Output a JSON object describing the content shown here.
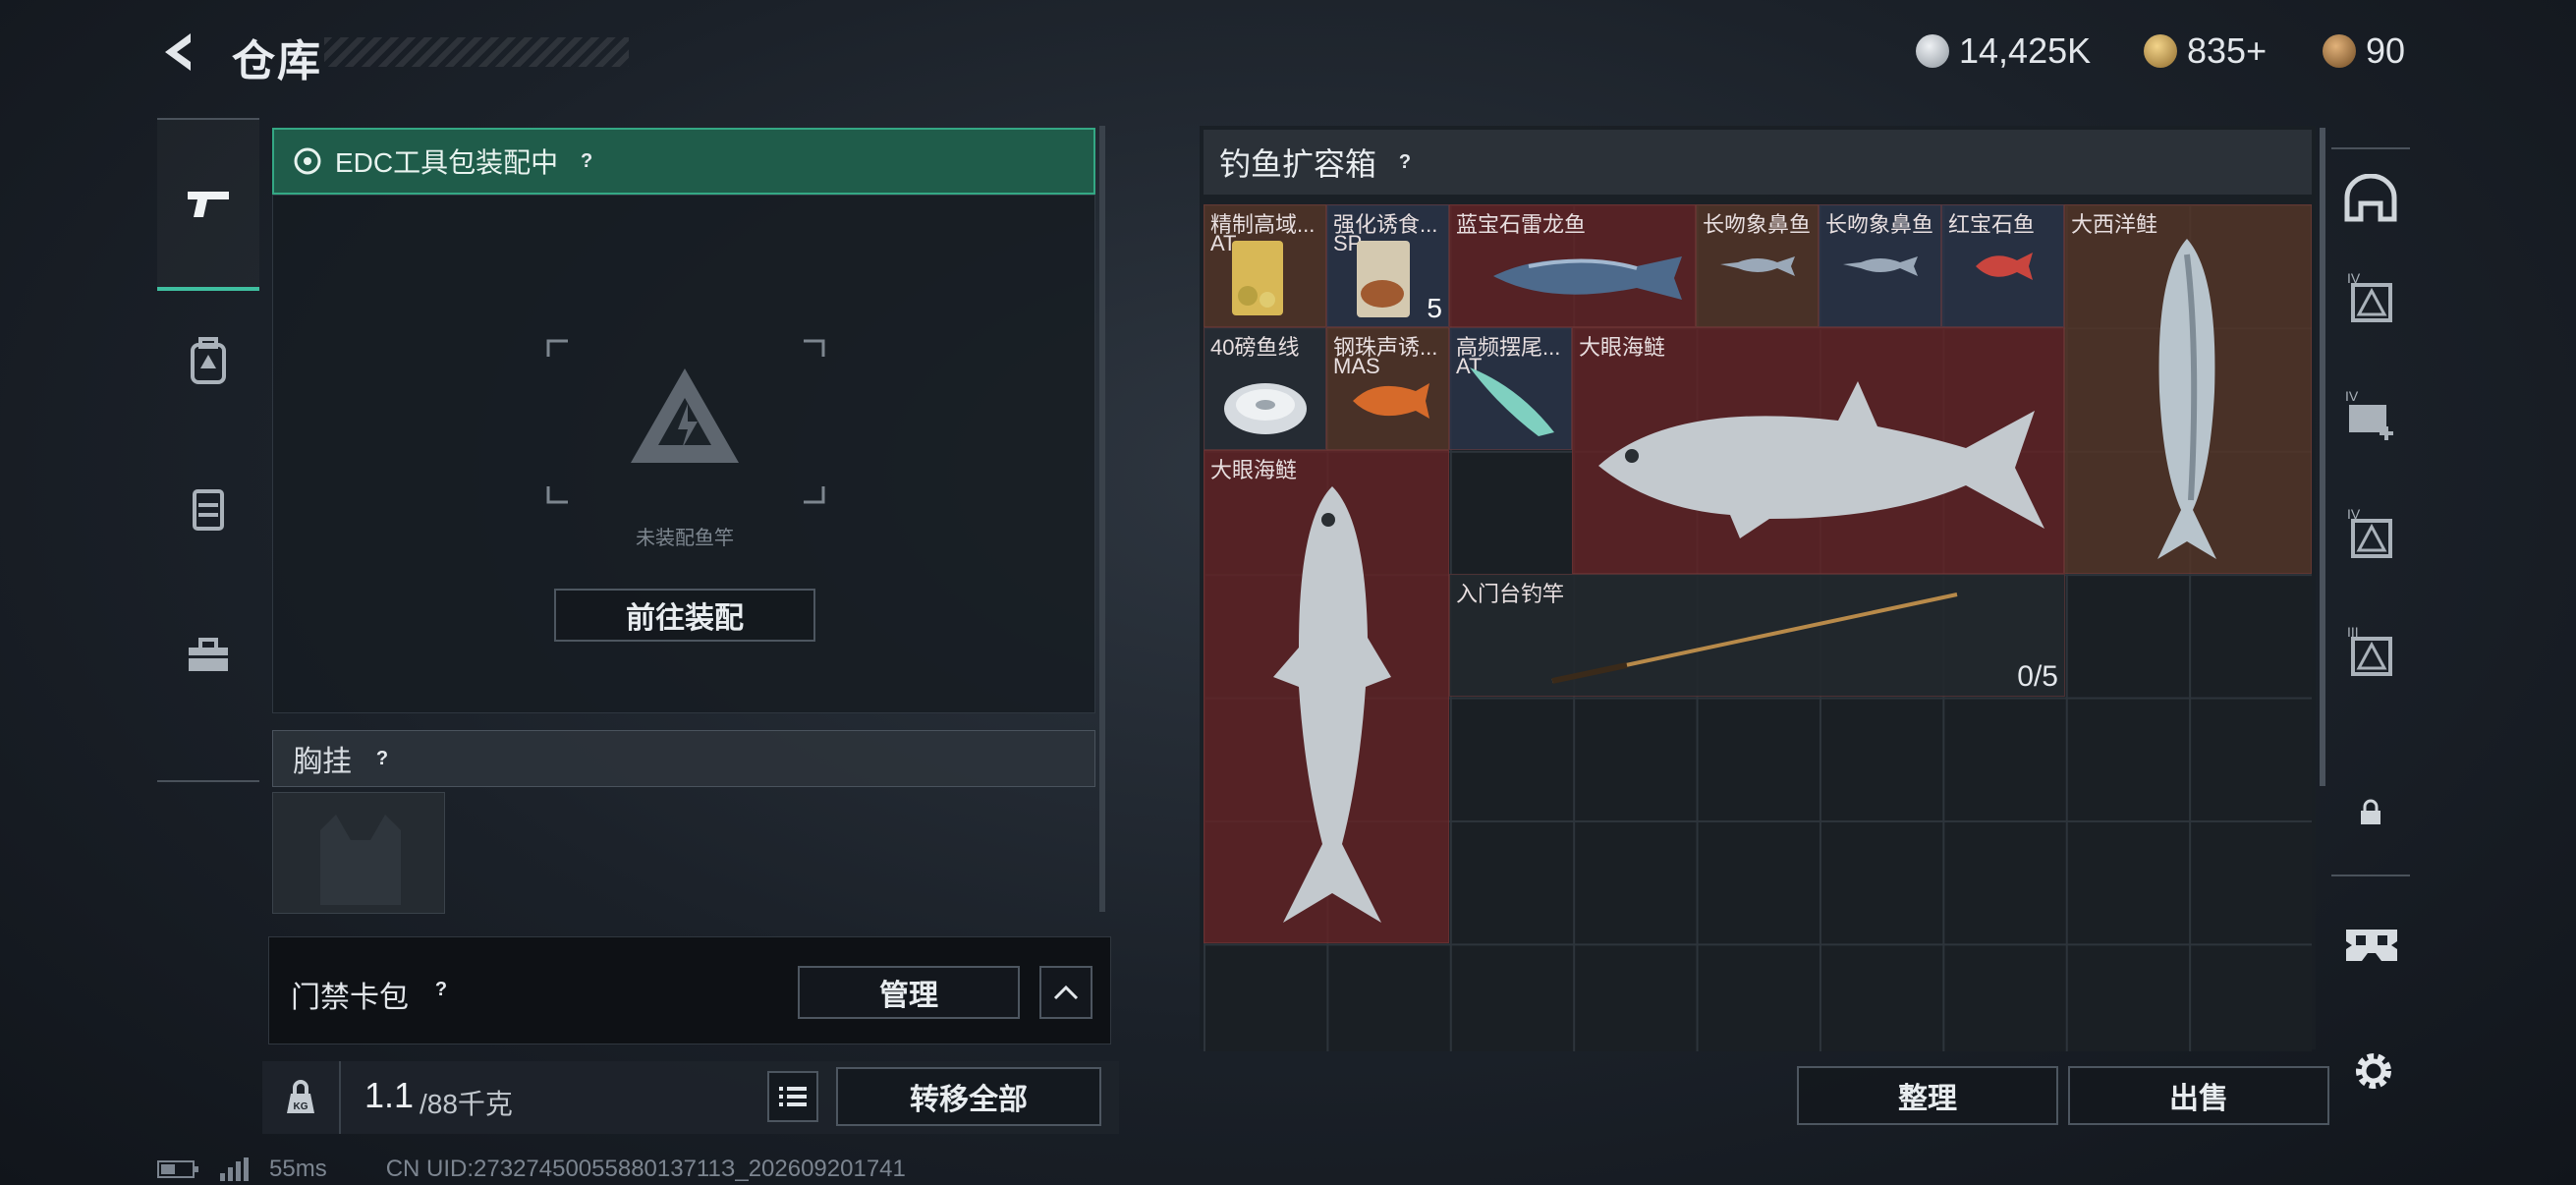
{
  "header": {
    "title": "仓库",
    "currencies": [
      {
        "icon": "silver-coin-icon",
        "value": "14,425K",
        "color": "#b9c0c7"
      },
      {
        "icon": "gold-triangle-coin-icon",
        "value": "835+",
        "color": "#c8a55a"
      },
      {
        "icon": "bronze-coin-icon",
        "value": "90",
        "color": "#b8864a"
      }
    ]
  },
  "left_tabs": [
    {
      "icon": "pistol-icon",
      "active": true
    },
    {
      "icon": "backpack-icon",
      "active": false
    },
    {
      "icon": "vest-icon",
      "active": false
    },
    {
      "icon": "toolbox-icon",
      "active": false
    }
  ],
  "edc": {
    "label": "EDC工具包装配中",
    "help": "?",
    "empty_text": "未装配鱼竿",
    "equip_button": "前往装配"
  },
  "chest_rig": {
    "label": "胸挂",
    "help": "?"
  },
  "keycard": {
    "label": "门禁卡包",
    "help": "?",
    "manage_button": "管理"
  },
  "weight": {
    "current": "1.1",
    "max": "/88千克",
    "kg_badge": "KG",
    "transfer_all_button": "转移全部"
  },
  "container": {
    "title": "钓鱼扩容箱",
    "help": "?",
    "sort_button": "整理",
    "sell_button": "出售",
    "items": [
      {
        "name": "精制高域...",
        "sub": "AT",
        "qty": "",
        "color": "tan",
        "icon": "bait-bag-icon"
      },
      {
        "name": "强化诱食...",
        "sub": "SP",
        "qty": "5",
        "color": "blue",
        "icon": "bait-bag-icon"
      },
      {
        "name": "蓝宝石雷龙鱼",
        "sub": "",
        "qty": "",
        "color": "red",
        "icon": "snakehead-fish-icon"
      },
      {
        "name": "长吻象鼻鱼",
        "sub": "",
        "qty": "",
        "color": "tan",
        "icon": "elephantnose-fish-icon"
      },
      {
        "name": "长吻象鼻鱼",
        "sub": "",
        "qty": "",
        "color": "blue",
        "icon": "elephantnose-fish-icon"
      },
      {
        "name": "红宝石鱼",
        "sub": "",
        "qty": "",
        "color": "blue",
        "icon": "red-fish-icon"
      },
      {
        "name": "大西洋鲑",
        "sub": "",
        "qty": "",
        "color": "tan",
        "icon": "salmon-icon"
      },
      {
        "name": "40磅鱼线",
        "sub": "",
        "qty": "",
        "color": "dark",
        "icon": "fishing-line-spool-icon"
      },
      {
        "name": "钢珠声诱...",
        "sub": "MAS",
        "qty": "",
        "color": "tan",
        "icon": "lure-icon"
      },
      {
        "name": "高频摆尾...",
        "sub": "AT",
        "qty": "",
        "color": "blue",
        "icon": "lure-icon"
      },
      {
        "name": "大眼海鲢",
        "sub": "",
        "qty": "",
        "color": "red",
        "icon": "tarpon-icon"
      },
      {
        "name": "大眼海鲢",
        "sub": "",
        "qty": "",
        "color": "red",
        "icon": "tarpon-icon"
      },
      {
        "name": "入门台钓竿",
        "sub": "",
        "qty": "0/5",
        "color": "dark",
        "icon": "fishing-rod-icon"
      }
    ]
  },
  "right_rail": [
    {
      "icon": "helmet-slot-icon"
    },
    {
      "icon": "armor-iv-icon"
    },
    {
      "icon": "medkit-iv-icon"
    },
    {
      "icon": "armor-iv-2-icon"
    },
    {
      "icon": "armor-iii-icon"
    },
    {
      "icon": "lock-icon"
    }
  ],
  "status_bar": {
    "ping": "55ms",
    "uid": "CN UID:2732745005588013711З_202609201741"
  }
}
